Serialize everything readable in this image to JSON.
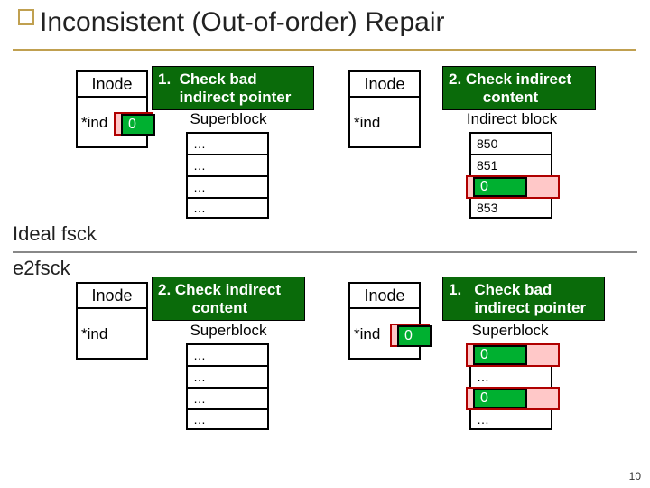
{
  "title": "Inconsistent (Out-of-order) Repair",
  "labels": {
    "inode": "Inode",
    "ind": "*ind",
    "zero": "0",
    "superblock": "Superblock",
    "indirect_block": "Indirect block",
    "ellipsis": "…"
  },
  "panels": {
    "check_bad": "1.  Check bad\n     indirect pointer",
    "check_content": "2. Check indirect\n        content",
    "check_bad2": "1.   Check bad\n      indirect pointer",
    "check_content2": "2. Check indirect\n        content"
  },
  "sections": {
    "ideal": "Ideal fsck",
    "e2": "e2fsck"
  },
  "right_list": {
    "r1": "850",
    "r2": "851",
    "r3_over": "0",
    "r4": "853"
  },
  "bottom_right_list": {
    "r1_over": "0",
    "r2": "…",
    "r3_over": "0",
    "r4": "…"
  },
  "slide_number": "10"
}
